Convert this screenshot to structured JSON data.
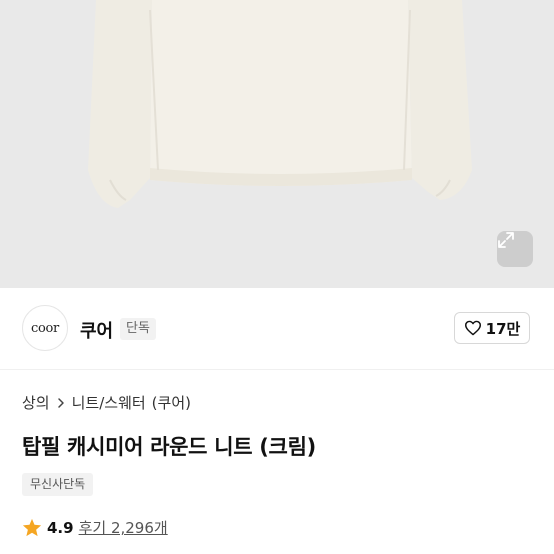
{
  "product_image": {
    "alt": ""
  },
  "brand": {
    "logo_text": "coor",
    "name": "쿠어",
    "badge": "단독"
  },
  "like": {
    "count": "17만"
  },
  "breadcrumb": {
    "items": [
      "상의",
      "니트/스웨터",
      "(쿠어)"
    ]
  },
  "product": {
    "title": "탑필 캐시미어 라운드 니트 (크림)",
    "tag": "무신사단독"
  },
  "rating": {
    "value": "4.9",
    "reviews_text": "후기 2,296개"
  },
  "colors": {
    "star": "#f5a623",
    "hero_bg": "#e9e9e9",
    "sweater": "#f3f0e8"
  },
  "icons": [
    "expand-icon",
    "heart-icon",
    "chevron-right-icon",
    "star-icon"
  ]
}
